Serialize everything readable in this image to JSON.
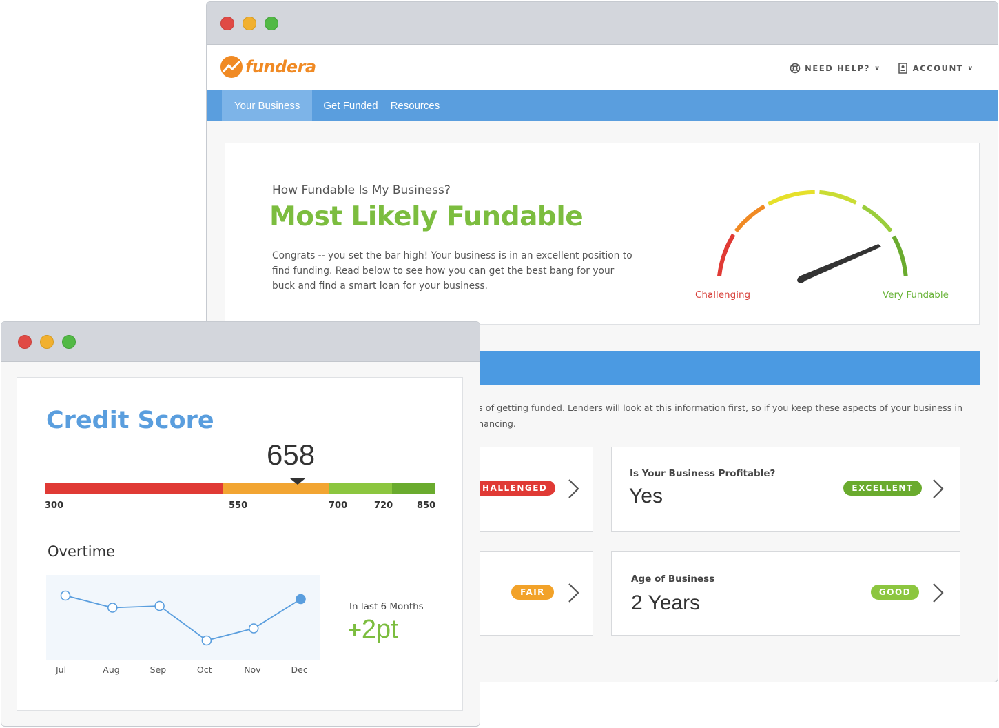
{
  "brand": {
    "name": "fundera",
    "color": "#f08a24"
  },
  "header": {
    "help_label": "NEED HELP?",
    "account_label": "ACCOUNT"
  },
  "nav": {
    "items": [
      {
        "label": "Your Business",
        "active": true
      },
      {
        "label": "Get Funded",
        "active": false
      },
      {
        "label": "Resources",
        "active": false
      }
    ]
  },
  "hero": {
    "question": "How Fundable Is My Business?",
    "result": "Most Likely Fundable",
    "description": "Congrats -- you set the bar high! Your business is in an excellent position to find funding. Read below to see how you can get the best bang for your buck and find a smart loan for your business.",
    "gauge_low_label": "Challenging",
    "gauge_high_label": "Very Fundable"
  },
  "section": {
    "intro_line1": "s of getting funded. Lenders will look at this information first, so if you keep these aspects of your business in",
    "intro_line2": "nancing."
  },
  "cards": [
    {
      "question": "",
      "answer": "",
      "badge": "HALLENGED",
      "badge_color": "#e03a35"
    },
    {
      "question": "Is Your Business Profitable?",
      "answer": "Yes",
      "badge": "EXCELLENT",
      "badge_color": "#6aab2e"
    },
    {
      "question": "",
      "answer": "",
      "badge": "FAIR",
      "badge_color": "#f2a229"
    },
    {
      "question": "Age of Business",
      "answer": "2 Years",
      "badge": "GOOD",
      "badge_color": "#8cc63f"
    }
  ],
  "credit": {
    "title": "Credit Score",
    "score": "658",
    "ticks": [
      "300",
      "550",
      "700",
      "720",
      "850"
    ],
    "overtime_label": "Overtime",
    "last_label": "In last 6 Months",
    "change": "2pt",
    "bands": [
      {
        "from": 300,
        "to": 550,
        "color": "#e03a35"
      },
      {
        "from": 550,
        "to": 700,
        "color": "#f2a532"
      },
      {
        "from": 700,
        "to": 790,
        "color": "#8cc63f"
      },
      {
        "from": 790,
        "to": 850,
        "color": "#6aab2e"
      }
    ]
  },
  "chart_data": {
    "type": "line",
    "categories": [
      "Jul",
      "Aug",
      "Sep",
      "Oct",
      "Nov",
      "Dec"
    ],
    "series": [
      {
        "values": [
          656,
          652.5,
          653,
          643,
          646.5,
          655
        ]
      }
    ],
    "ylim": [
      640,
      660
    ],
    "color": "#5a9ede"
  }
}
